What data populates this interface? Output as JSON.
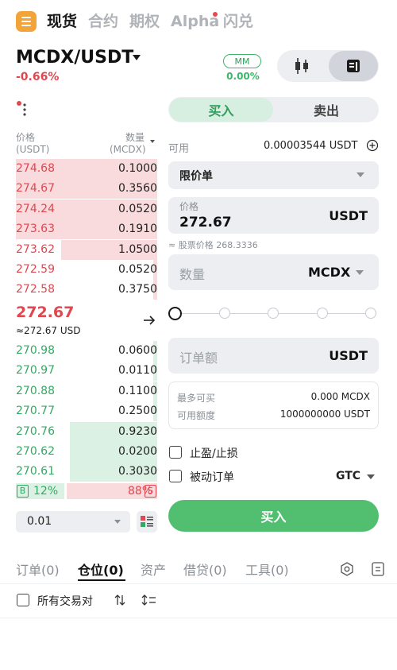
{
  "nav": {
    "tabs": [
      {
        "label": "现货"
      },
      {
        "label": "合约"
      },
      {
        "label": "期权"
      },
      {
        "label": "Alpha"
      },
      {
        "label": "闪兑"
      }
    ],
    "active_tab": "现货",
    "icons": {
      "menu": "menu-icon",
      "notification_dot": "red-dot"
    }
  },
  "pair": {
    "symbol": "MCDX/USDT",
    "change": "-0.66%",
    "mm_badge": "MM",
    "mm_pct": "0.00%"
  },
  "colors": {
    "sell_red": "#e0474f",
    "buy_green": "#35a864",
    "buy_button": "#52bf70",
    "accent_orange": "#f2a33a"
  },
  "orderbook": {
    "price_header": "价格",
    "price_unit": "(USDT)",
    "qty_header": "数量",
    "qty_unit": "(MCDX)",
    "asks": [
      {
        "price": "274.68",
        "qty": "0.1000",
        "depth": 1.0
      },
      {
        "price": "274.67",
        "qty": "0.3560",
        "depth": 1.0
      },
      {
        "price": "274.24",
        "qty": "0.0520",
        "depth": 1.0
      },
      {
        "price": "273.63",
        "qty": "0.1910",
        "depth": 1.0
      },
      {
        "price": "273.62",
        "qty": "1.0500",
        "depth": 0.68
      },
      {
        "price": "272.59",
        "qty": "0.0520",
        "depth": 0.03
      },
      {
        "price": "272.58",
        "qty": "0.3750",
        "depth": 0.03
      }
    ],
    "mid_price": "272.67",
    "mid_usd": "≈272.67 USD",
    "bids": [
      {
        "price": "270.98",
        "qty": "0.0600",
        "depth": 0.03
      },
      {
        "price": "270.97",
        "qty": "0.0110",
        "depth": 0.03
      },
      {
        "price": "270.88",
        "qty": "0.1100",
        "depth": 0.03
      },
      {
        "price": "270.77",
        "qty": "0.2500",
        "depth": 0.03
      },
      {
        "price": "270.76",
        "qty": "0.9230",
        "depth": 0.62
      },
      {
        "price": "270.62",
        "qty": "0.0200",
        "depth": 0.62
      },
      {
        "price": "270.61",
        "qty": "0.3030",
        "depth": 0.62
      }
    ],
    "buy_ratio_badge": "B",
    "buy_ratio": "12%",
    "sell_ratio": "88%",
    "sell_ratio_badge": "S",
    "depth_value": "0.01"
  },
  "trade": {
    "buy_tab": "买入",
    "sell_tab": "卖出",
    "available_label": "可用",
    "available_value": "0.00003544 USDT",
    "order_type": "限价单",
    "price_label": "价格",
    "price_value": "272.67",
    "price_unit": "USDT",
    "stock_price_note": "≈ 股票价格 268.3336",
    "qty_placeholder": "数量",
    "qty_unit": "MCDX",
    "slider_level": 0,
    "total_placeholder": "订单额",
    "total_unit": "USDT",
    "max_buy_label": "最多可买",
    "max_buy_value": "0.000 MCDX",
    "credit_label": "可用额度",
    "credit_value": "1000000000 USDT",
    "tp_sl_label": "止盈/止损",
    "post_only_label": "被动订单",
    "tif_value": "GTC",
    "submit_label": "买入"
  },
  "bottom": {
    "tabs": [
      "订单(0)",
      "仓位(0)",
      "资产",
      "借贷(0)",
      "工具(0)"
    ],
    "active_tab": "仓位(0)",
    "all_pairs_label": "所有交易对"
  }
}
